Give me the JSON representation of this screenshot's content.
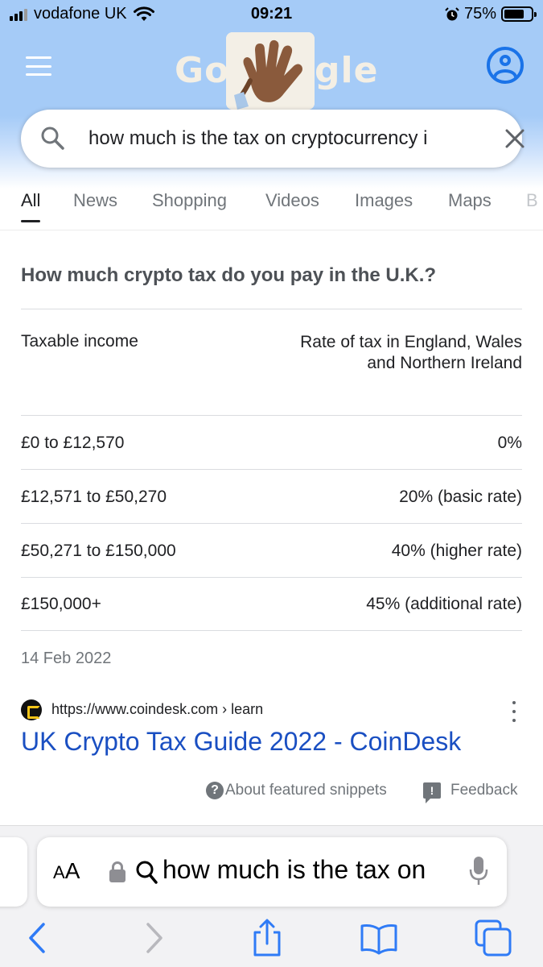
{
  "status_bar": {
    "carrier": "vodafone UK",
    "time": "09:21",
    "battery": "75%",
    "battery_level": 0.75
  },
  "header": {
    "doodle_left": "Go",
    "doodle_right": "gle",
    "search_query": "how much is the tax on cryptocurrency i"
  },
  "tabs": [
    {
      "label": "All",
      "active": true
    },
    {
      "label": "News"
    },
    {
      "label": "Shopping"
    },
    {
      "label": "Videos"
    },
    {
      "label": "Images"
    },
    {
      "label": "Maps"
    },
    {
      "label": "B"
    }
  ],
  "snippet": {
    "question": "How much crypto tax do you pay in the U.K.?",
    "headers": {
      "left": "Taxable income",
      "right": "Rate of tax in England, Wales and Northern Ireland"
    },
    "rows": [
      {
        "income": "£0 to £12,570",
        "rate": "0%"
      },
      {
        "income": "£12,571 to £50,270",
        "rate": "20% (basic rate)"
      },
      {
        "income": "£50,271 to £150,000",
        "rate": "40% (higher rate)"
      },
      {
        "income": "£150,000+",
        "rate": "45% (additional rate)"
      }
    ],
    "date": "14 Feb 2022",
    "source_url": "https://www.coindesk.com › learn",
    "result_title": "UK Crypto Tax Guide 2022 - CoinDesk",
    "about_label": "About featured snippets",
    "feedback_label": "Feedback"
  },
  "safari": {
    "aa_small": "A",
    "aa_large": "A",
    "address_text": "how much is the tax on"
  },
  "colors": {
    "header_blue": "#a5cbf7",
    "link_blue": "#1a4fc2",
    "safari_blue": "#2f7bf6"
  }
}
